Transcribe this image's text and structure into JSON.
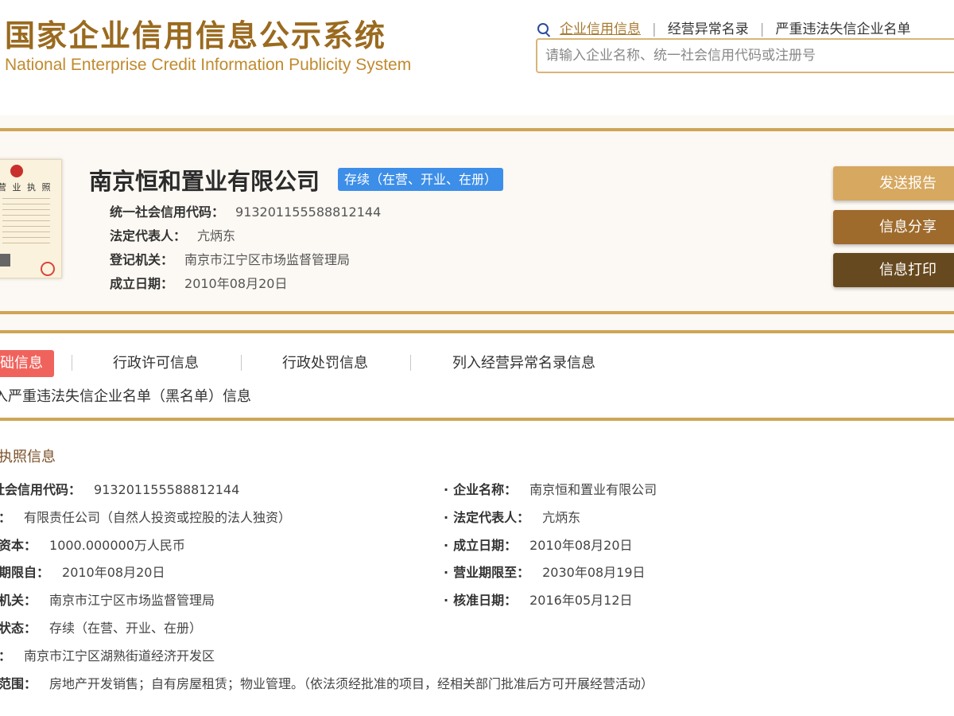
{
  "header": {
    "logo_cn": "国家企业信用信息公示系统",
    "logo_en": "National Enterprise Credit Information Publicity System",
    "nav": [
      "企业信用信息",
      "经营异常名录",
      "严重违法失信企业名单"
    ],
    "search_placeholder": "请输入企业名称、统一社会信用代码或注册号"
  },
  "company": {
    "name": "南京恒和置业有限公司",
    "status": "存续（在营、开业、在册）",
    "fields": [
      {
        "label": "统一社会信用代码：",
        "value": "913201155588812144"
      },
      {
        "label": "法定代表人：",
        "value": "亢炳东"
      },
      {
        "label": "登记机关：",
        "value": "南京市江宁区市场监督管理局"
      },
      {
        "label": "成立日期：",
        "value": "2010年08月20日"
      }
    ],
    "license_title": "营 业 执 照"
  },
  "actions": {
    "send": "发送报告",
    "share": "信息分享",
    "print": "信息打印"
  },
  "tabs": {
    "active": "础信息",
    "items": [
      "行政许可信息",
      "行政处罚信息",
      "列入经营异常名录信息"
    ],
    "second_row": "入严重违法失信企业名单（黑名单）信息"
  },
  "detail": {
    "title": "执照信息",
    "left": [
      {
        "label": "社会信用代码：",
        "value": "913201155588812144"
      },
      {
        "label": "：",
        "value": "有限责任公司（自然人投资或控股的法人独资）"
      },
      {
        "label": "资本：",
        "value": "1000.000000万人民币"
      },
      {
        "label": "期限自：",
        "value": "2010年08月20日"
      },
      {
        "label": "机关：",
        "value": "南京市江宁区市场监督管理局"
      },
      {
        "label": "状态：",
        "value": "存续（在营、开业、在册）"
      },
      {
        "label": "：",
        "value": "南京市江宁区湖熟街道经济开发区"
      },
      {
        "label": "范围：",
        "value": "房地产开发销售；自有房屋租赁；物业管理。（依法须经批准的项目，经相关部门批准后方可开展经营活动）"
      }
    ],
    "right": [
      {
        "label": "企业名称：",
        "value": "南京恒和置业有限公司"
      },
      {
        "label": "法定代表人：",
        "value": "亢炳东"
      },
      {
        "label": "成立日期：",
        "value": "2010年08月20日"
      },
      {
        "label": "营业期限至：",
        "value": "2030年08月19日"
      },
      {
        "label": "核准日期：",
        "value": "2016年05月12日"
      }
    ]
  },
  "colors": {
    "gold": "#cfa556",
    "brand_brown": "#9a6a1f",
    "badge_blue": "#3c8ee8",
    "tab_active_red": "#f0635c",
    "btn_send": "#d6a860",
    "btn_share": "#9e6b2c",
    "btn_print": "#67491f"
  }
}
